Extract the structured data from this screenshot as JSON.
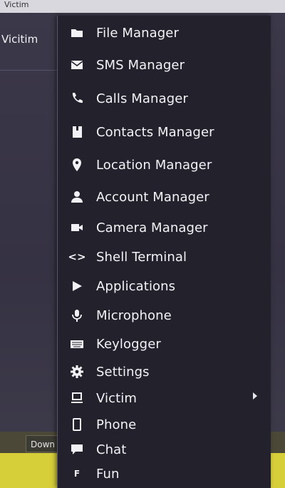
{
  "app": {
    "titlebar_text": "Victim",
    "tab_label": "Vicitim",
    "down_button_label": "Down"
  },
  "menu": {
    "items": [
      {
        "label": "File Manager",
        "icon": "folder-icon"
      },
      {
        "label": "SMS Manager",
        "icon": "envelope-icon"
      },
      {
        "label": "Calls Manager",
        "icon": "phone-handset-icon"
      },
      {
        "label": "Contacts Manager",
        "icon": "contacts-book-icon"
      },
      {
        "label": "Location Manager",
        "icon": "map-pin-icon"
      },
      {
        "label": "Account Manager",
        "icon": "user-icon"
      },
      {
        "label": "Camera Manager",
        "icon": "video-camera-icon"
      },
      {
        "label": "Shell Terminal",
        "icon": "code-brackets-icon",
        "glyph": "<>"
      },
      {
        "label": "Applications",
        "icon": "play-icon"
      },
      {
        "label": "Microphone",
        "icon": "microphone-icon"
      },
      {
        "label": "Keylogger",
        "icon": "keyboard-icon"
      },
      {
        "label": "Settings",
        "icon": "gear-icon"
      },
      {
        "label": "Victim",
        "icon": "computer-icon",
        "has_submenu": true
      },
      {
        "label": "Phone",
        "icon": "mobile-phone-icon"
      },
      {
        "label": "Chat",
        "icon": "chat-bubble-icon"
      },
      {
        "label": "Fun",
        "icon": "letter-f-icon",
        "glyph": "F"
      }
    ]
  },
  "colors": {
    "menu_background": "#22212c",
    "menu_text": "#f3f3f7",
    "bottom_bar": "#d7cf3a"
  }
}
